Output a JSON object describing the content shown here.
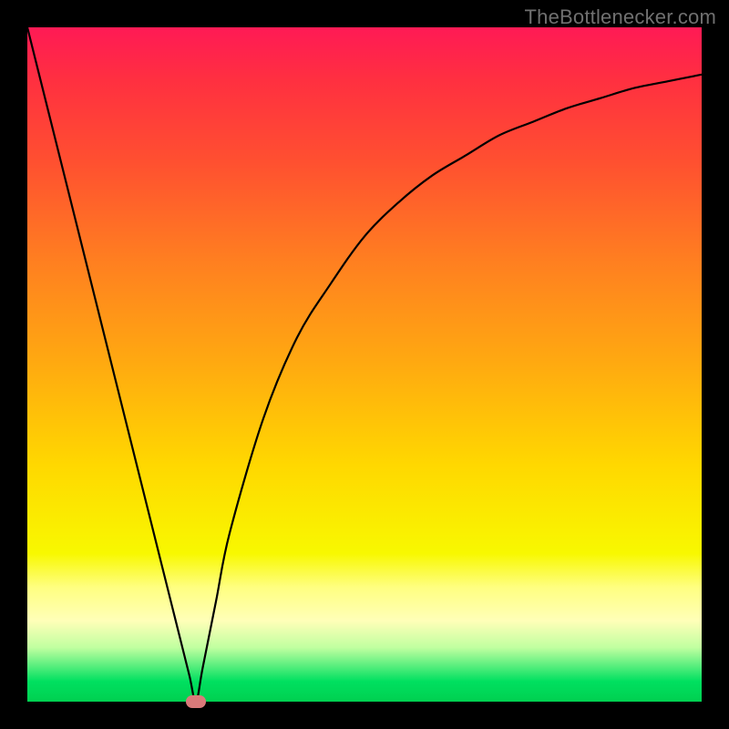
{
  "watermark": "TheBottlenecker.com",
  "chart_data": {
    "type": "line",
    "title": "",
    "xlabel": "",
    "ylabel": "",
    "xlim": [
      0,
      100
    ],
    "ylim": [
      0,
      100
    ],
    "x": [
      0,
      5,
      10,
      15,
      20,
      22,
      24,
      25,
      26,
      28,
      30,
      35,
      40,
      45,
      50,
      55,
      60,
      65,
      70,
      75,
      80,
      85,
      90,
      95,
      100
    ],
    "y": [
      100,
      80,
      60,
      40,
      20,
      12,
      4,
      0,
      5,
      15,
      25,
      42,
      54,
      62,
      69,
      74,
      78,
      81,
      84,
      86,
      88,
      89.5,
      91,
      92,
      93
    ],
    "marker": {
      "x": 25,
      "y": 0
    },
    "background_gradient": {
      "top": "#ff1a55",
      "mid_upper": "#ff8020",
      "mid": "#ffd800",
      "mid_lower": "#ffff80",
      "bottom": "#00d050"
    }
  }
}
